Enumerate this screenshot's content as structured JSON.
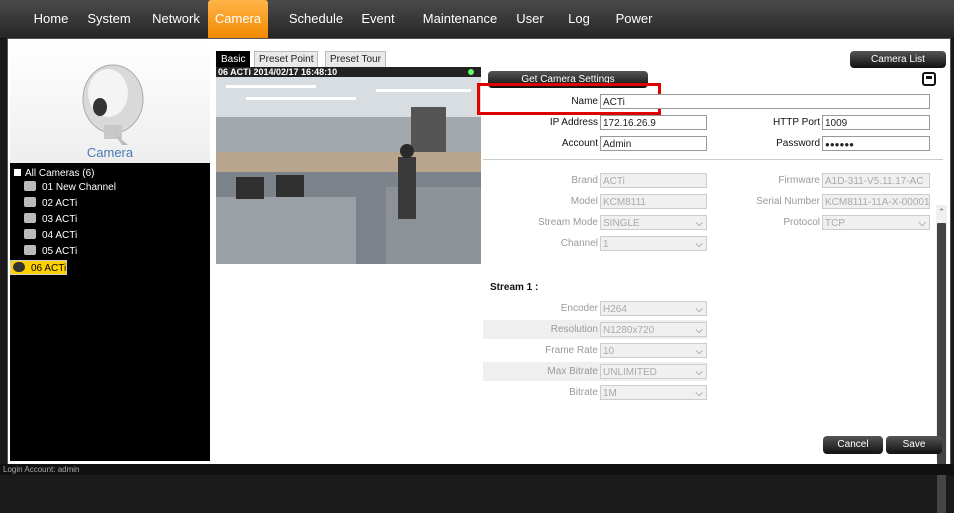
{
  "menu": [
    "Home",
    "System",
    "Network",
    "Camera",
    "Schedule",
    "Event",
    "Maintenance",
    "User",
    "Log",
    "Power"
  ],
  "camera_title": "Camera",
  "tree": {
    "header": "All Cameras (6)",
    "items": [
      {
        "label": "01  New Channel"
      },
      {
        "label": "02  ACTi"
      },
      {
        "label": "03  ACTi"
      },
      {
        "label": "04  ACTi"
      },
      {
        "label": "05  ACTi"
      },
      {
        "label": "06  ACTi",
        "selected": true
      }
    ]
  },
  "tabs": [
    "Basic",
    "Preset Point",
    "Preset Tour"
  ],
  "video_header": "06 ACTi  2014/02/17 16:48:10",
  "buttons": {
    "get_settings": "Get Camera Settings",
    "camera_list": "Camera List",
    "cancel": "Cancel",
    "save": "Save"
  },
  "form": {
    "name_label": "Name",
    "name_value": "ACTi",
    "ip_label": "IP Address",
    "ip_value": "172.16.26.9",
    "http_label": "HTTP Port",
    "http_value": "1009",
    "account_label": "Account",
    "account_value": "Admin",
    "password_label": "Password",
    "password_value": "●●●●●●",
    "brand_label": "Brand",
    "brand_value": "ACTi",
    "firmware_label": "Firmware",
    "firmware_value": "A1D-311-V5.11.17-AC",
    "model_label": "Model",
    "model_value": "KCM8111",
    "serial_label": "Serial Number",
    "serial_value": "KCM8111-11A-X-00001",
    "stream_mode_label": "Stream Mode",
    "stream_mode_value": "SINGLE",
    "protocol_label": "Protocol",
    "protocol_value": "TCP",
    "channel_label": "Channel",
    "channel_value": "1"
  },
  "stream": {
    "title": "Stream 1 :",
    "encoder_label": "Encoder",
    "encoder_value": "H264",
    "resolution_label": "Resolution",
    "resolution_value": "N1280x720",
    "framerate_label": "Frame Rate",
    "framerate_value": "10",
    "maxbitrate_label": "Max Bitrate",
    "maxbitrate_value": "UNLIMITED",
    "bitrate_label": "Bitrate",
    "bitrate_value": "1M"
  },
  "status_text": "Login Account: admin",
  "colors": {
    "accent": "#f28a00",
    "highlight_box": "#e00000",
    "selected_row": "#ffd000"
  }
}
